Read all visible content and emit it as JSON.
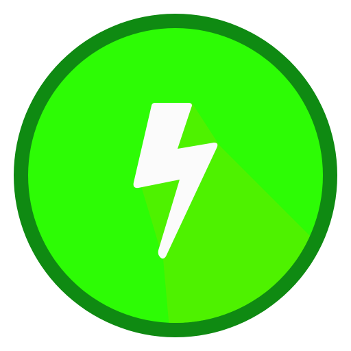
{
  "icon": {
    "name": "lightning-bolt-icon",
    "colors": {
      "outer_ring": "#0f8a12",
      "disc": "#2dfc05",
      "long_shadow": "#4ef200",
      "bolt": "#fbfbfb"
    }
  }
}
